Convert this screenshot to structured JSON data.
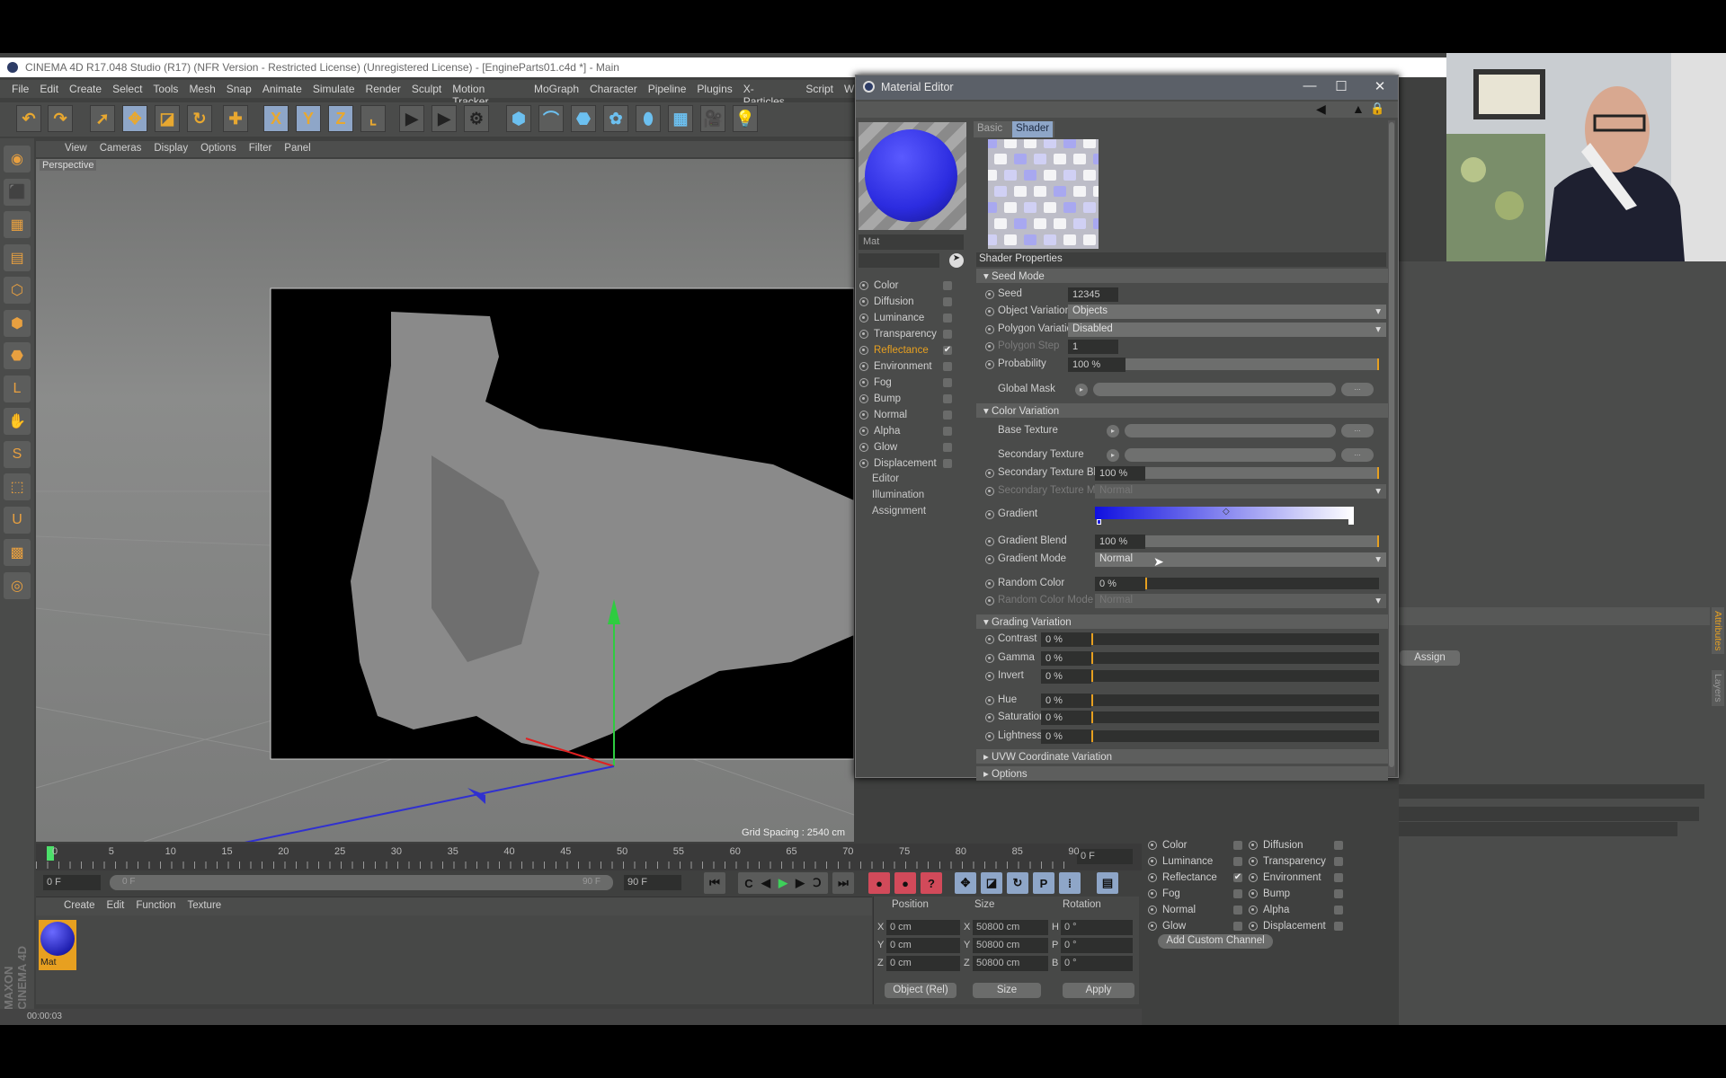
{
  "app": {
    "title": "CINEMA 4D R17.048 Studio (R17) (NFR Version - Restricted License) (Unregistered License) - [EngineParts01.c4d *] - Main"
  },
  "menu": [
    "File",
    "Edit",
    "Create",
    "Select",
    "Tools",
    "Mesh",
    "Snap",
    "Animate",
    "Simulate",
    "Render",
    "Sculpt",
    "Motion Tracker",
    "MoGraph",
    "Character",
    "Pipeline",
    "Plugins",
    "X-Particles",
    "Script",
    "Wi"
  ],
  "toolbar_icons": [
    "undo-icon",
    "redo-icon",
    "live-select-icon",
    "move-icon",
    "scale-icon",
    "rotate-icon",
    "add-icon",
    "x-axis-icon",
    "y-axis-icon",
    "z-axis-icon",
    "coordinate-system-icon",
    "render-view-icon",
    "render-picture-viewer-icon",
    "render-settings-icon",
    "cube-icon",
    "spline-icon",
    "nurbs-icon",
    "array-icon",
    "deformer-icon",
    "floor-icon",
    "camera-icon",
    "light-icon"
  ],
  "viewport": {
    "menu": [
      "View",
      "Cameras",
      "Display",
      "Options",
      "Filter",
      "Panel"
    ],
    "label": "Perspective",
    "grid_spacing": "Grid Spacing : 2540 cm"
  },
  "timeline": {
    "ticks": [
      "0",
      "5",
      "10",
      "15",
      "20",
      "25",
      "30",
      "35",
      "40",
      "45",
      "50",
      "55",
      "60",
      "65",
      "70",
      "75",
      "80",
      "85",
      "90"
    ],
    "current_frame": "0 F",
    "start": "0 F",
    "range_start": "0 F",
    "range_end": "90 F",
    "end": "90 F"
  },
  "material_manager": {
    "menu": [
      "Create",
      "Edit",
      "Function",
      "Texture"
    ],
    "materials": [
      {
        "name": "Mat",
        "color": "#3a3ae0"
      }
    ]
  },
  "coords": {
    "headers": [
      "Position",
      "Size",
      "Rotation"
    ],
    "rows": [
      {
        "axis": "X",
        "pos": "0 cm",
        "size_axis": "X",
        "size": "50800 cm",
        "rot_axis": "H",
        "rot": "0 °"
      },
      {
        "axis": "Y",
        "pos": "0 cm",
        "size_axis": "Y",
        "size": "50800 cm",
        "rot_axis": "P",
        "rot": "0 °"
      },
      {
        "axis": "Z",
        "pos": "0 cm",
        "size_axis": "Z",
        "size": "50800 cm",
        "rot_axis": "B",
        "rot": "0 °"
      }
    ],
    "mode": "Object (Rel)",
    "size_mode": "Size",
    "apply": "Apply"
  },
  "status": {
    "time": "00:00:03"
  },
  "brand": "MAXON CINEMA 4D",
  "material_editor": {
    "title": "Material Editor",
    "material_name": "Mat",
    "tabs": [
      "Basic",
      "Shader"
    ],
    "active_tab": "Shader",
    "channels": [
      {
        "label": "Color",
        "checked": false
      },
      {
        "label": "Diffusion",
        "checked": false
      },
      {
        "label": "Luminance",
        "checked": false
      },
      {
        "label": "Transparency",
        "checked": false
      },
      {
        "label": "Reflectance",
        "checked": true,
        "active": true
      },
      {
        "label": "Environment",
        "checked": false
      },
      {
        "label": "Fog",
        "checked": false
      },
      {
        "label": "Bump",
        "checked": false
      },
      {
        "label": "Normal",
        "checked": false
      },
      {
        "label": "Alpha",
        "checked": false
      },
      {
        "label": "Glow",
        "checked": false
      },
      {
        "label": "Displacement",
        "checked": false
      }
    ],
    "extra": [
      "Editor",
      "Illumination",
      "Assignment"
    ],
    "section_title": "Shader Properties",
    "rows": [
      {
        "type": "section",
        "label": "Seed Mode"
      },
      {
        "type": "num",
        "label": "Seed",
        "value": "12345"
      },
      {
        "type": "dd",
        "label": "Object Variation",
        "value": "Objects"
      },
      {
        "type": "dd",
        "label": "Polygon Variation",
        "value": "Disabled"
      },
      {
        "type": "num",
        "label": "Polygon Step",
        "value": "1",
        "disabled": true
      },
      {
        "type": "slider",
        "label": "Probability",
        "value": "100 %",
        "percent": 100
      },
      {
        "type": "link",
        "label": "Global Mask",
        "noradio": true
      },
      {
        "type": "section",
        "label": "Color Variation"
      },
      {
        "type": "link",
        "label": "Base Texture",
        "noradio": true
      },
      {
        "type": "link",
        "label": "Secondary Texture",
        "noradio": true
      },
      {
        "type": "slider",
        "label": "Secondary Texture Blend",
        "value": "100 %",
        "percent": 100
      },
      {
        "type": "dd",
        "label": "Secondary Texture Mode",
        "value": "Normal",
        "disabled": true
      },
      {
        "type": "gradient",
        "label": "Gradient",
        "stops": [
          "#1010e0",
          "#ffffff"
        ]
      },
      {
        "type": "slider",
        "label": "Gradient Blend",
        "value": "100 %",
        "percent": 100
      },
      {
        "type": "dd",
        "label": "Gradient Mode",
        "value": "Normal"
      },
      {
        "type": "slider",
        "label": "Random Color",
        "value": "0 %",
        "percent": 0
      },
      {
        "type": "dd",
        "label": "Random Color Mode",
        "value": "Normal",
        "disabled": true
      },
      {
        "type": "section",
        "label": "Grading Variation"
      },
      {
        "type": "slider",
        "label": "Contrast",
        "value": "0 %",
        "percent": 0
      },
      {
        "type": "slider",
        "label": "Gamma",
        "value": "0 %",
        "percent": 0
      },
      {
        "type": "slider",
        "label": "Invert",
        "value": "0 %",
        "percent": 0
      },
      {
        "type": "slider",
        "label": "Hue",
        "value": "0 %",
        "percent": 0
      },
      {
        "type": "slider",
        "label": "Saturation",
        "value": "0 %",
        "percent": 0
      },
      {
        "type": "slider",
        "label": "Lightness",
        "value": "0 %",
        "percent": 0
      },
      {
        "type": "section",
        "label": "UVW Coordinate Variation",
        "collapsed": true
      },
      {
        "type": "section",
        "label": "Options",
        "collapsed": true
      }
    ]
  },
  "attributes": {
    "assign": "Assign",
    "channels": [
      {
        "label": "Color",
        "checked": false
      },
      {
        "label": "Diffusion",
        "checked": false
      },
      {
        "label": "Luminance",
        "checked": false
      },
      {
        "label": "Transparency",
        "checked": false
      },
      {
        "label": "Reflectance",
        "checked": true
      },
      {
        "label": "Environment",
        "checked": false
      },
      {
        "label": "Fog",
        "checked": false
      },
      {
        "label": "Bump",
        "checked": false
      },
      {
        "label": "Normal",
        "checked": false
      },
      {
        "label": "Alpha",
        "checked": false
      },
      {
        "label": "Glow",
        "checked": false
      },
      {
        "label": "Displacement",
        "checked": false
      }
    ],
    "add_channel": "Add Custom Channel",
    "side_tabs": [
      "Attributes",
      "Layers"
    ]
  },
  "colors": {
    "accent": "#e7a020",
    "material": "#3a3ae0",
    "selected_tool": "#8ea6c8"
  }
}
